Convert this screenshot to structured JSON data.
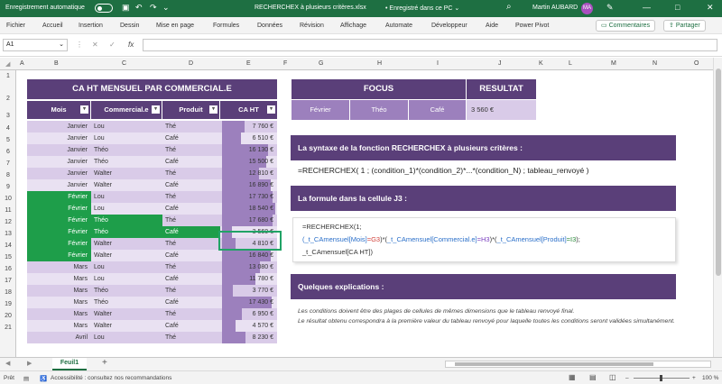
{
  "titlebar": {
    "autosave": "Enregistrement automatique",
    "filename": "RECHERCHEX à plusieurs critères.xlsx",
    "saved": "• Enregistré dans ce PC ⌄",
    "user": "Martin AUBARD",
    "initials": "MA"
  },
  "menu": {
    "items": [
      "Fichier",
      "Accueil",
      "Insertion",
      "Dessin",
      "Mise en page",
      "Formules",
      "Données",
      "Révision",
      "Affichage",
      "Automate",
      "Développeur",
      "Aide",
      "Power Pivot"
    ],
    "comments": "Commentaires",
    "share": "Partager"
  },
  "formula_bar": {
    "cell_ref": "A1",
    "fx": "fx",
    "cancel": "✕",
    "confirm": "✓"
  },
  "columns": [
    "A",
    "B",
    "C",
    "D",
    "E",
    "F",
    "G",
    "H",
    "I",
    "J",
    "K",
    "L",
    "M",
    "N",
    "O"
  ],
  "rows": [
    "1",
    "2",
    "3",
    "4",
    "5",
    "6",
    "7",
    "8",
    "9",
    "10",
    "11",
    "12",
    "13",
    "14",
    "15",
    "16",
    "17",
    "18",
    "19",
    "20",
    "21"
  ],
  "table": {
    "title": "CA HT MENSUEL PAR COMMERCIAL.E",
    "headers": [
      "Mois",
      "Commercial.e",
      "Produit",
      "CA HT"
    ],
    "rows": [
      {
        "mois": "Janvier",
        "commercial": "Lou",
        "produit": "Thé",
        "ca": "7 760 €",
        "v": 7760
      },
      {
        "mois": "Janvier",
        "commercial": "Lou",
        "produit": "Café",
        "ca": "6 510 €",
        "v": 6510
      },
      {
        "mois": "Janvier",
        "commercial": "Théo",
        "produit": "Thé",
        "ca": "16 130 €",
        "v": 16130
      },
      {
        "mois": "Janvier",
        "commercial": "Théo",
        "produit": "Café",
        "ca": "15 500 €",
        "v": 15500
      },
      {
        "mois": "Janvier",
        "commercial": "Walter",
        "produit": "Thé",
        "ca": "12 810 €",
        "v": 12810
      },
      {
        "mois": "Janvier",
        "commercial": "Walter",
        "produit": "Café",
        "ca": "16 890 €",
        "v": 16890
      },
      {
        "mois": "Février",
        "commercial": "Lou",
        "produit": "Thé",
        "ca": "17 730 €",
        "v": 17730
      },
      {
        "mois": "Février",
        "commercial": "Lou",
        "produit": "Café",
        "ca": "18 540 €",
        "v": 18540
      },
      {
        "mois": "Février",
        "commercial": "Théo",
        "produit": "Thé",
        "ca": "17 680 €",
        "v": 17680
      },
      {
        "mois": "Février",
        "commercial": "Théo",
        "produit": "Café",
        "ca": "3 560 €",
        "v": 3560
      },
      {
        "mois": "Février",
        "commercial": "Walter",
        "produit": "Thé",
        "ca": "4 810 €",
        "v": 4810
      },
      {
        "mois": "Février",
        "commercial": "Walter",
        "produit": "Café",
        "ca": "16 840 €",
        "v": 16840
      },
      {
        "mois": "Mars",
        "commercial": "Lou",
        "produit": "Thé",
        "ca": "13 080 €",
        "v": 13080
      },
      {
        "mois": "Mars",
        "commercial": "Lou",
        "produit": "Café",
        "ca": "11 780 €",
        "v": 11780
      },
      {
        "mois": "Mars",
        "commercial": "Théo",
        "produit": "Thé",
        "ca": "3 770 €",
        "v": 3770
      },
      {
        "mois": "Mars",
        "commercial": "Théo",
        "produit": "Café",
        "ca": "17 430 €",
        "v": 17430
      },
      {
        "mois": "Mars",
        "commercial": "Walter",
        "produit": "Thé",
        "ca": "6 950 €",
        "v": 6950
      },
      {
        "mois": "Mars",
        "commercial": "Walter",
        "produit": "Café",
        "ca": "4 570 €",
        "v": 4570
      },
      {
        "mois": "Avril",
        "commercial": "Lou",
        "produit": "Thé",
        "ca": "8 230 €",
        "v": 8230
      }
    ]
  },
  "focus": {
    "title": "FOCUS",
    "result_title": "RESULTAT",
    "values": [
      "Février",
      "Théo",
      "Café"
    ],
    "result": "3 560 €"
  },
  "section1": {
    "title": "La syntaxe de la fonction RECHERCHEX à plusieurs critères :",
    "syntax": "=RECHERCHEX( 1 ; (condition_1)*(condition_2)*...*(condition_N) ; tableau_renvoyé )"
  },
  "section2": {
    "title": "La formule dans la cellule J3 :",
    "line1": "=RECHERCHEX(1;",
    "line2": [
      {
        "t": "(_t_CAmensuel[Mois]",
        "c": "#2a6fc9"
      },
      {
        "t": "=G3",
        "c": "#d0403a"
      },
      {
        "t": ")*(",
        "c": "#333"
      },
      {
        "t": "_t_CAmensuel[Commercial.e]",
        "c": "#2a6fc9"
      },
      {
        "t": "=H3",
        "c": "#7a3fbf"
      },
      {
        "t": ")*(",
        "c": "#333"
      },
      {
        "t": "_t_CAmensuel[Produit]",
        "c": "#2a6fc9"
      },
      {
        "t": "=I3",
        "c": "#2a8a3a"
      },
      {
        "t": ");",
        "c": "#333"
      }
    ],
    "line3": "_t_CAmensuel[CA HT])"
  },
  "section3": {
    "title": "Quelques explications :",
    "text1": "Les conditions doivent être des plages de cellules de mêmes dimensions que le tableau renvoyé final.",
    "text2": "Le résultat obtenu correspondra à la première valeur du tableau renvoyé pour laquelle toutes les conditions seront validées simultanément."
  },
  "sheet": {
    "tab": "Feuil1",
    "add": "+"
  },
  "status": {
    "ready": "Prêt",
    "accessibility": "Accessibilité : consultez nos recommandations",
    "zoom": "100 %"
  },
  "colors": {
    "purple_dark": "#5a3f79",
    "purple_mid": "#9c80bd",
    "purple_light": "#d9cbe8",
    "green_hl": "#1e9e4a",
    "excel_green": "#1e6f42"
  }
}
